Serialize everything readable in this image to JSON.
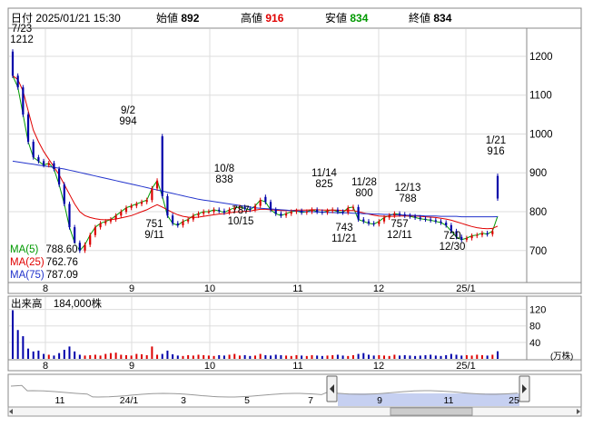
{
  "header": {
    "date_label": "日付",
    "datetime": "2025/01/21 15:30",
    "open_label": "始値",
    "open": "892",
    "high_label": "高値",
    "high": "916",
    "low_label": "安値",
    "low": "834",
    "close_label": "終値",
    "close": "834"
  },
  "ma": {
    "ma5_label": "MA(5)",
    "ma5": "788.60",
    "ma25_label": "MA(25)",
    "ma25": "762.76",
    "ma75_label": "MA(75)",
    "ma75": "787.09"
  },
  "volume": {
    "title": "出来高",
    "value": "184,000株",
    "unit": "(万株)"
  },
  "colors": {
    "up": "#dd0000",
    "down": "#0000aa",
    "ma5": "#009900",
    "ma25": "#e00000",
    "ma75": "#2233cc",
    "nav_fill": "#b8c4ee"
  },
  "chart_data": [
    {
      "type": "line",
      "name": "price",
      "x_ticks": [
        "8",
        "9",
        "10",
        "11",
        "12",
        "25/1"
      ],
      "y_ticks": [
        700,
        800,
        900,
        1000,
        1100,
        1200
      ],
      "ylim": [
        620,
        1270
      ],
      "annotations": [
        {
          "date": "7/23",
          "value": "1212"
        },
        {
          "date": "9/2",
          "value": "994"
        },
        {
          "date": "9/11",
          "value": "751"
        },
        {
          "date": "10/8",
          "value": "838"
        },
        {
          "date": "10/15",
          "value": "787"
        },
        {
          "date": "11/14",
          "value": "825"
        },
        {
          "date": "11/21",
          "value": "743"
        },
        {
          "date": "11/28",
          "value": "800"
        },
        {
          "date": "12/11",
          "value": "757"
        },
        {
          "date": "12/13",
          "value": "788"
        },
        {
          "date": "12/30",
          "value": "720"
        },
        {
          "date": "1/21",
          "value": "916"
        }
      ],
      "series": [
        {
          "name": "close",
          "values": [
            1150,
            1120,
            1050,
            980,
            940,
            930,
            920,
            925,
            910,
            870,
            820,
            760,
            720,
            700,
            715,
            740,
            760,
            770,
            775,
            780,
            790,
            800,
            810,
            815,
            820,
            825,
            830,
            860,
            880,
            840,
            790,
            770,
            765,
            775,
            780,
            790,
            795,
            800,
            800,
            805,
            802,
            798,
            805,
            810,
            812,
            808,
            805,
            815,
            830,
            825,
            805,
            795,
            790,
            795,
            800,
            802,
            798,
            800,
            805,
            800,
            798,
            802,
            805,
            800,
            798,
            810,
            812,
            780,
            775,
            770,
            768,
            775,
            785,
            790,
            795,
            793,
            790,
            788,
            785,
            782,
            780,
            778,
            775,
            772,
            765,
            750,
            735,
            728,
            732,
            738,
            740,
            745,
            742,
            750,
            834
          ]
        },
        {
          "name": "MA(5)",
          "values": [
            1150,
            1120,
            1050,
            980,
            940,
            930,
            920,
            925,
            910,
            870,
            820,
            760,
            720,
            700,
            715,
            740,
            760,
            770,
            775,
            780,
            790,
            800,
            810,
            815,
            820,
            825,
            830,
            860,
            880,
            840,
            790,
            770,
            765,
            775,
            780,
            790,
            795,
            800,
            800,
            805,
            802,
            798,
            805,
            810,
            812,
            808,
            805,
            815,
            830,
            825,
            805,
            795,
            790,
            795,
            800,
            802,
            798,
            800,
            805,
            800,
            798,
            802,
            805,
            800,
            798,
            810,
            812,
            780,
            775,
            770,
            768,
            775,
            785,
            790,
            795,
            793,
            790,
            788,
            785,
            782,
            780,
            778,
            775,
            772,
            765,
            750,
            735,
            728,
            732,
            738,
            740,
            745,
            742,
            750,
            788.6
          ]
        },
        {
          "name": "MA(25)",
          "values": [
            1150,
            1140,
            1110,
            1060,
            1010,
            980,
            955,
            935,
            915,
            895,
            870,
            845,
            820,
            800,
            790,
            785,
            782,
            780,
            779,
            780,
            781,
            784,
            787,
            790,
            795,
            800,
            805,
            812,
            818,
            812,
            805,
            798,
            792,
            788,
            786,
            785,
            786,
            788,
            790,
            792,
            794,
            795,
            797,
            799,
            800,
            801,
            802,
            804,
            806,
            806,
            805,
            804,
            803,
            803,
            803,
            804,
            804,
            804,
            805,
            805,
            804,
            804,
            804,
            804,
            803,
            803,
            803,
            800,
            797,
            794,
            791,
            789,
            788,
            788,
            788,
            789,
            789,
            789,
            789,
            788,
            787,
            786,
            785,
            783,
            781,
            778,
            774,
            770,
            766,
            762,
            759,
            757,
            756,
            757,
            762.76
          ]
        },
        {
          "name": "MA(75)",
          "values": [
            930,
            928,
            926,
            924,
            922,
            920,
            918,
            916,
            914,
            912,
            910,
            907,
            904,
            901,
            898,
            895,
            892,
            889,
            886,
            883,
            880,
            877,
            874,
            871,
            868,
            865,
            862,
            859,
            856,
            853,
            850,
            847,
            844,
            841,
            838,
            835,
            832,
            830,
            828,
            826,
            824,
            822,
            820,
            818,
            816,
            814,
            812,
            810,
            809,
            808,
            807,
            806,
            805,
            804,
            803,
            802,
            801,
            800,
            800,
            799,
            799,
            798,
            798,
            797,
            797,
            797,
            796,
            796,
            795,
            795,
            794,
            794,
            793,
            793,
            792,
            792,
            791,
            791,
            790,
            790,
            789,
            789,
            789,
            788,
            788,
            788,
            788,
            787,
            787,
            787,
            787,
            787,
            787,
            787,
            787.09
          ]
        }
      ]
    },
    {
      "type": "bar",
      "name": "volume",
      "y_ticks": [
        40,
        80,
        120
      ],
      "ylim": [
        0,
        150
      ],
      "values": [
        118,
        70,
        55,
        25,
        18,
        20,
        12,
        10,
        8,
        14,
        22,
        30,
        18,
        10,
        8,
        9,
        10,
        8,
        12,
        14,
        15,
        10,
        9,
        8,
        12,
        11,
        9,
        30,
        10,
        12,
        20,
        11,
        8,
        7,
        9,
        8,
        10,
        9,
        8,
        7,
        9,
        8,
        10,
        12,
        8,
        9,
        7,
        8,
        12,
        9,
        8,
        10,
        9,
        8,
        7,
        9,
        8,
        7,
        9,
        8,
        7,
        8,
        9,
        10,
        8,
        7,
        9,
        12,
        14,
        10,
        8,
        9,
        8,
        7,
        10,
        8,
        9,
        8,
        7,
        8,
        9,
        10,
        8,
        7,
        9,
        12,
        10,
        8,
        9,
        8,
        10,
        9,
        8,
        10,
        18.4
      ]
    },
    {
      "type": "area",
      "name": "navigator",
      "x_ticks": [
        "11",
        "24/1",
        "3",
        "5",
        "7",
        "9",
        "11",
        "25"
      ]
    }
  ]
}
